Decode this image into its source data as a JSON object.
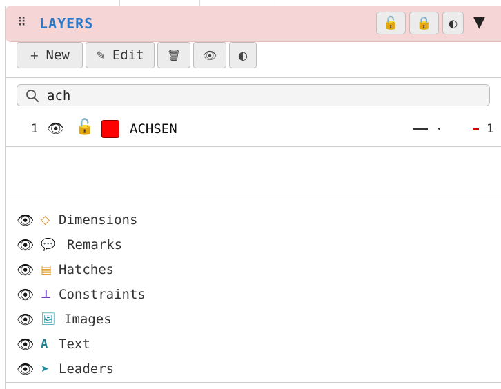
{
  "panel": {
    "title": "LAYERS",
    "grip_icon": "⠿",
    "header_buttons": [
      {
        "name": "unlock-all-button",
        "icon": "🔓"
      },
      {
        "name": "lock-all-button",
        "icon": "🔒"
      },
      {
        "name": "contrast-button",
        "icon": "◐"
      }
    ],
    "collapse_icon": "▼"
  },
  "toolbar": {
    "new_icon": "+",
    "new_label": "New",
    "edit_icon": "✎",
    "edit_label": "Edit",
    "delete_icon": "🗑",
    "visibility_icon": "👁",
    "contrast_icon": "◐"
  },
  "search": {
    "value": "ach"
  },
  "layers": [
    {
      "index": "1",
      "visibility_icon": "👁",
      "lock_icon": "🔓",
      "color": "#ff0000",
      "name": "ACHSEN",
      "count": "1"
    }
  ],
  "categories": [
    {
      "icon": "◇",
      "icon_color": "#d98b1a",
      "label": "Dimensions"
    },
    {
      "icon": "💬",
      "icon_color": "#666666",
      "label": "Remarks"
    },
    {
      "icon": "▤",
      "icon_color": "#e0951a",
      "label": "Hatches"
    },
    {
      "icon": "⊥",
      "icon_color": "#6a3fb5",
      "label": "Constraints"
    },
    {
      "icon": "🖼",
      "icon_color": "#1a8fa0",
      "label": "Images"
    },
    {
      "icon": "A",
      "icon_color": "#1a7f8f",
      "label": "Text"
    },
    {
      "icon": "➤",
      "icon_color": "#1a8f9a",
      "label": "Leaders"
    }
  ],
  "eye_icon": "👁",
  "colors": {
    "header_bg": "#f5d5d5",
    "title": "#2b78c6",
    "layer_color": "#ff0000"
  }
}
